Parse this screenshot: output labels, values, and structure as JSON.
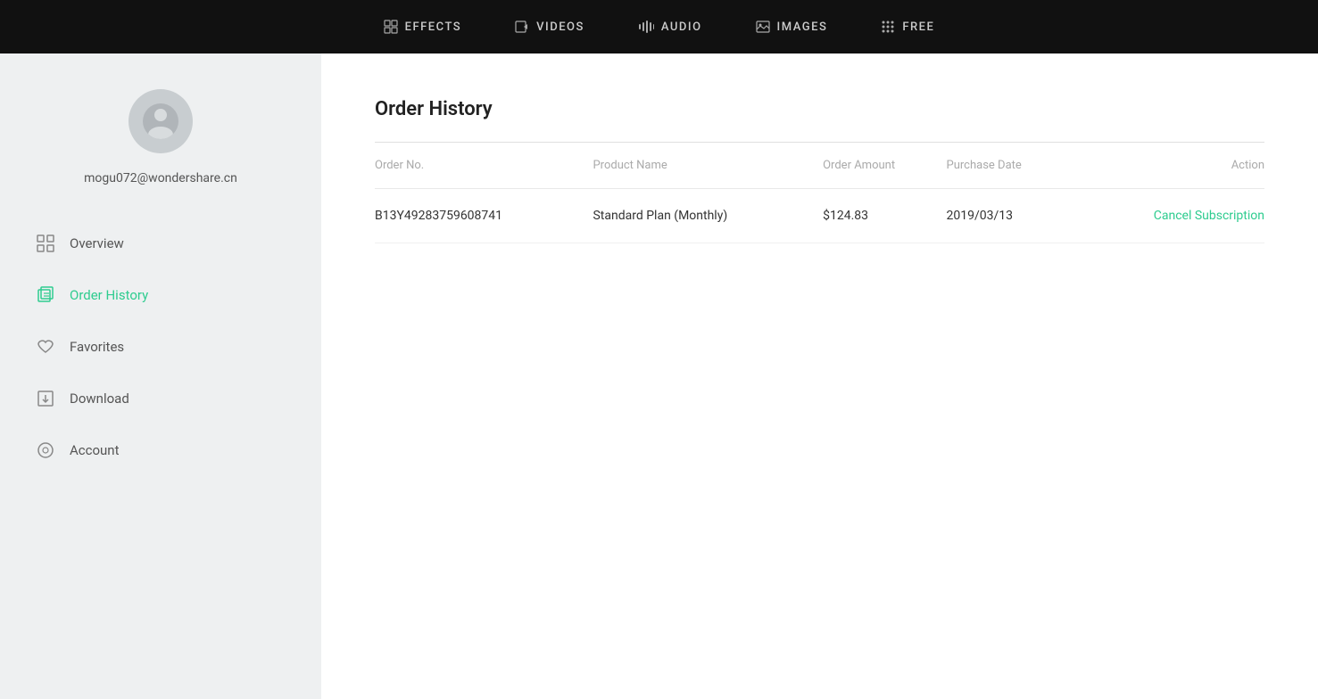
{
  "topnav": {
    "items": [
      {
        "id": "effects",
        "label": "EFFECTS",
        "icon": "effects"
      },
      {
        "id": "videos",
        "label": "VIDEOS",
        "icon": "videos"
      },
      {
        "id": "audio",
        "label": "AUDIO",
        "icon": "audio"
      },
      {
        "id": "images",
        "label": "IMAGES",
        "icon": "images"
      },
      {
        "id": "free",
        "label": "FREE",
        "icon": "free"
      }
    ]
  },
  "sidebar": {
    "user_email": "mogu072@wondershare.cn",
    "nav_items": [
      {
        "id": "overview",
        "label": "Overview",
        "active": false
      },
      {
        "id": "order-history",
        "label": "Order History",
        "active": true
      },
      {
        "id": "favorites",
        "label": "Favorites",
        "active": false
      },
      {
        "id": "download",
        "label": "Download",
        "active": false
      },
      {
        "id": "account",
        "label": "Account",
        "active": false
      }
    ]
  },
  "order_history": {
    "title": "Order History",
    "table": {
      "headers": [
        "Order No.",
        "Product Name",
        "Order Amount",
        "Purchase Date",
        "Action"
      ],
      "rows": [
        {
          "order_no": "B13Y49283759608741",
          "product_name": "Standard Plan (Monthly)",
          "order_amount": "$124.83",
          "purchase_date": "2019/03/13",
          "action": "Cancel Subscription"
        }
      ]
    }
  }
}
